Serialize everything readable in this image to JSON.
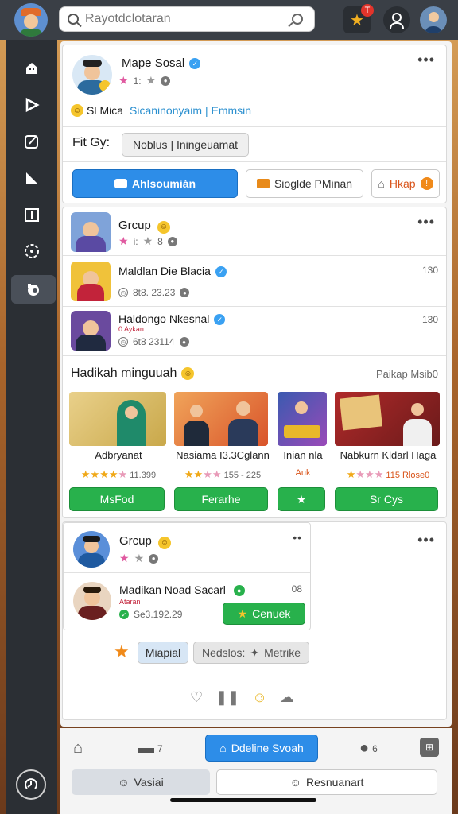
{
  "header": {
    "search_placeholder": "Rayotdclotaran",
    "notif_count": "T"
  },
  "profile_card": {
    "name": "Mape Sosal",
    "rating": "1:",
    "subtitle_prefix": "Sl",
    "subtitle_mid": "Mica",
    "subtitle_link": "Sicaninonyaim | Emmsin",
    "filter_label": "Fit Gy:",
    "filter_value": "Noblus | Iningeuamat",
    "btn_primary": "Ahlsoumián",
    "btn_secondary": "Sioglde PMinan",
    "btn_tertiary": "Hkap"
  },
  "group_card": {
    "group_name": "Grcup",
    "group_rating": "i:",
    "group_count": "8",
    "members": [
      {
        "name": "Maldlan Die Blacia",
        "meta": "8t8. 23.23",
        "count": "130"
      },
      {
        "name": "Haldongo Nkesnal",
        "sub": "0 Aykan",
        "meta": "6t8 23114",
        "count": "130"
      }
    ],
    "section_title": "Hadikah minguuah",
    "section_link": "Paikap Msib0",
    "tiles": [
      {
        "title": "Adbryanat",
        "rating": "11.399",
        "button": "MsFod"
      },
      {
        "title": "Nasiama I3.3Cglann",
        "rating": "155 - 225",
        "button": "Ferarhe"
      },
      {
        "title": "Inian nla",
        "rating": "Auk",
        "button": "★"
      },
      {
        "title": "Nabkurn Kldarl Haga",
        "rating": "115 Rlose0",
        "button": "Sr Cys"
      }
    ]
  },
  "group_card2": {
    "group_name": "Grcup",
    "member_name": "Madikan Noad Sacarl",
    "member_sub": "Ataran",
    "member_meta": "Se3.192.29",
    "member_count": "08",
    "member_button": "Cenuek",
    "tag1": "Miapial",
    "tag2": "Nedslos:",
    "tag3": "Metrike"
  },
  "bottom_nav": {
    "chat_count": "7",
    "primary_button": "Ddeline Svoah",
    "people_count": "6",
    "tab_left": "Vasiai",
    "tab_right": "Resnuanart"
  }
}
